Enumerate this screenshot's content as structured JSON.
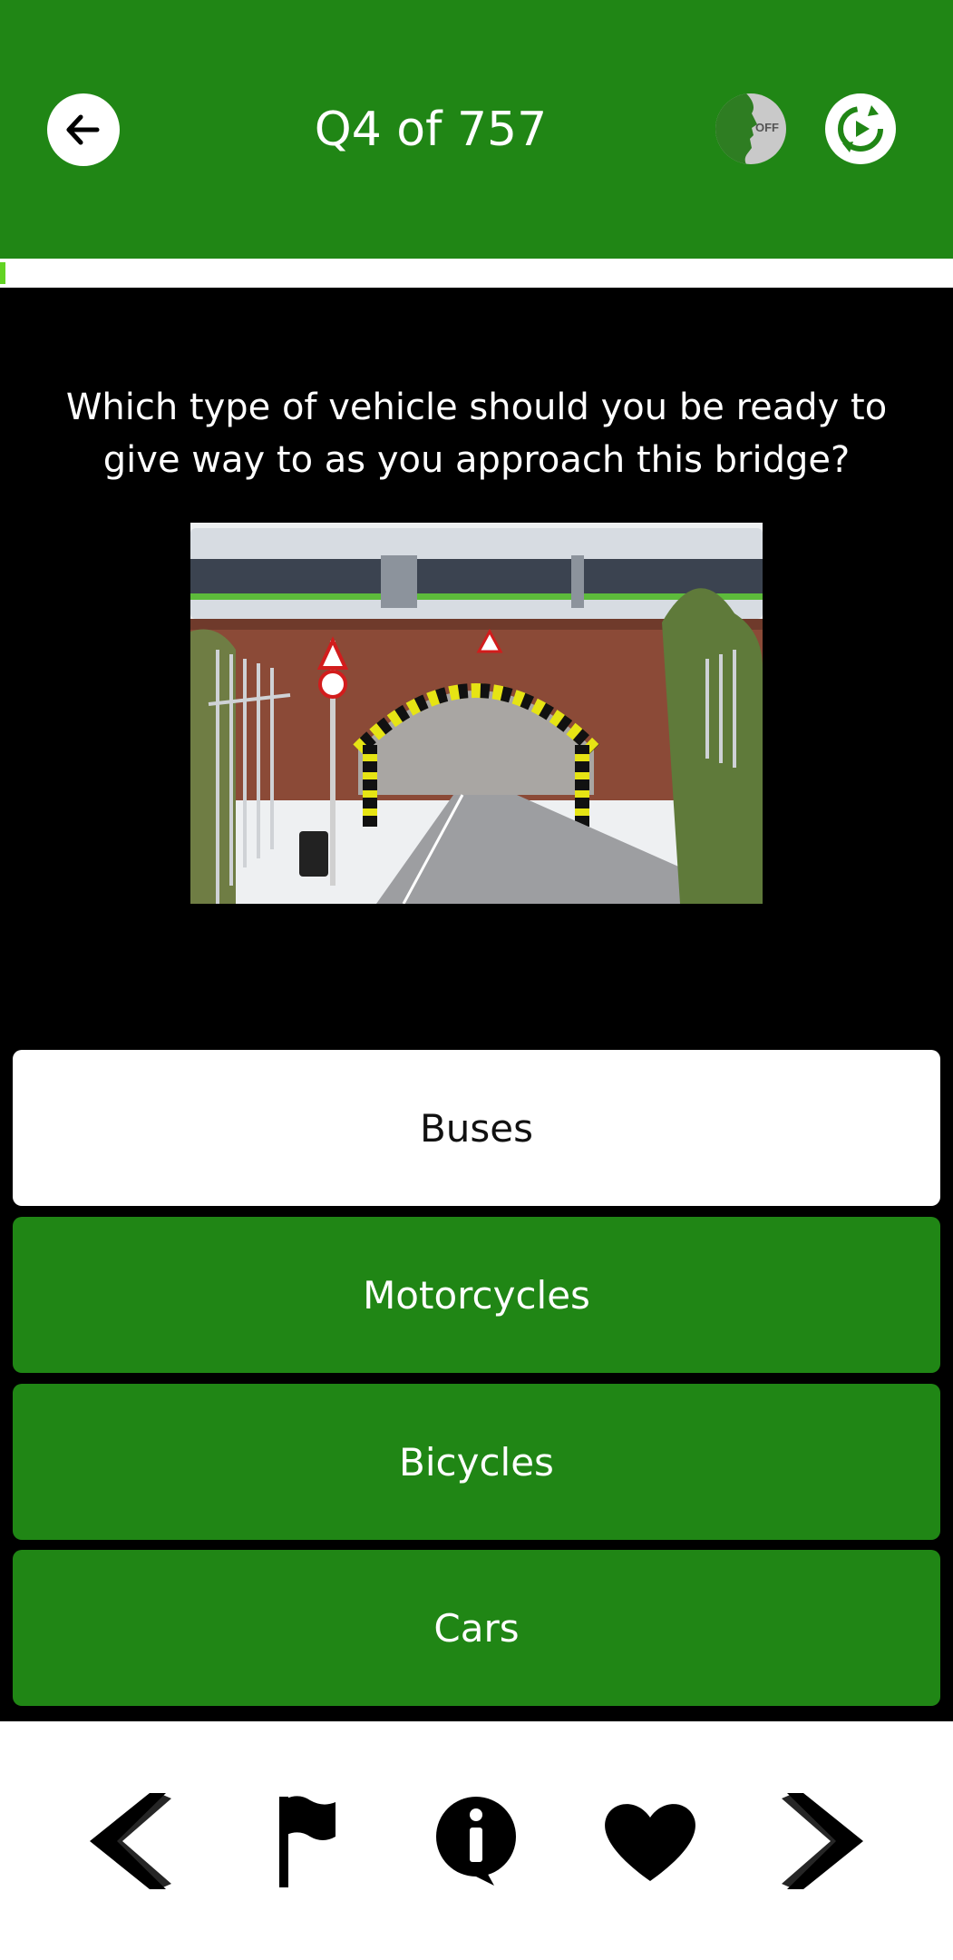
{
  "header": {
    "title": "Q4 of 757",
    "voice_toggle_label": "OFF",
    "colors": {
      "bar": "#208615",
      "progress": "#62d323"
    }
  },
  "progress": {
    "current": 4,
    "total": 757,
    "fraction": 0.0053
  },
  "question": {
    "text": "Which type of vehicle should you be ready to give way to as you approach this bridge?"
  },
  "answers": [
    {
      "label": "Buses",
      "style": "white"
    },
    {
      "label": "Motorcycles",
      "style": "green"
    },
    {
      "label": "Bicycles",
      "style": "green"
    },
    {
      "label": "Cars",
      "style": "green"
    }
  ],
  "footer": {
    "icons": [
      "chevron-left-icon",
      "flag-icon",
      "info-icon",
      "heart-icon",
      "chevron-right-icon"
    ]
  }
}
